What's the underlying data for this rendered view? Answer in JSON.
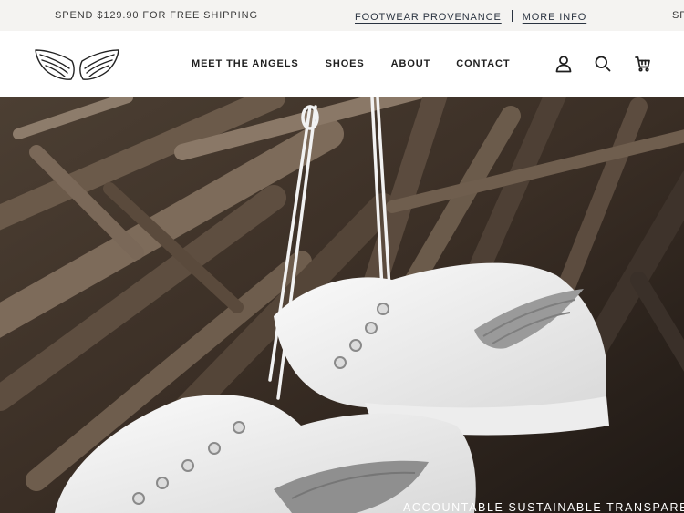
{
  "announcement": {
    "shipping_text": "Spend $129.90 for free shipping",
    "provenance_link": "Footwear Provenance",
    "more_info_link": "More Info",
    "repeat_text": "Sp"
  },
  "header": {
    "logo_icon": "angel-wings-icon",
    "nav": [
      {
        "label": "Meet the Angels"
      },
      {
        "label": "Shoes"
      },
      {
        "label": "About"
      },
      {
        "label": "Contact"
      }
    ],
    "icons": [
      "account-icon",
      "search-icon",
      "cart-icon"
    ]
  },
  "hero": {
    "image": "white sneakers with embroidered wings hanging on branches",
    "caption": "Accountable Sustainable Transparent"
  },
  "colors": {
    "announcement_bg": "#f4f3f1",
    "text": "#1f1f1f",
    "link": "#2a3340"
  }
}
